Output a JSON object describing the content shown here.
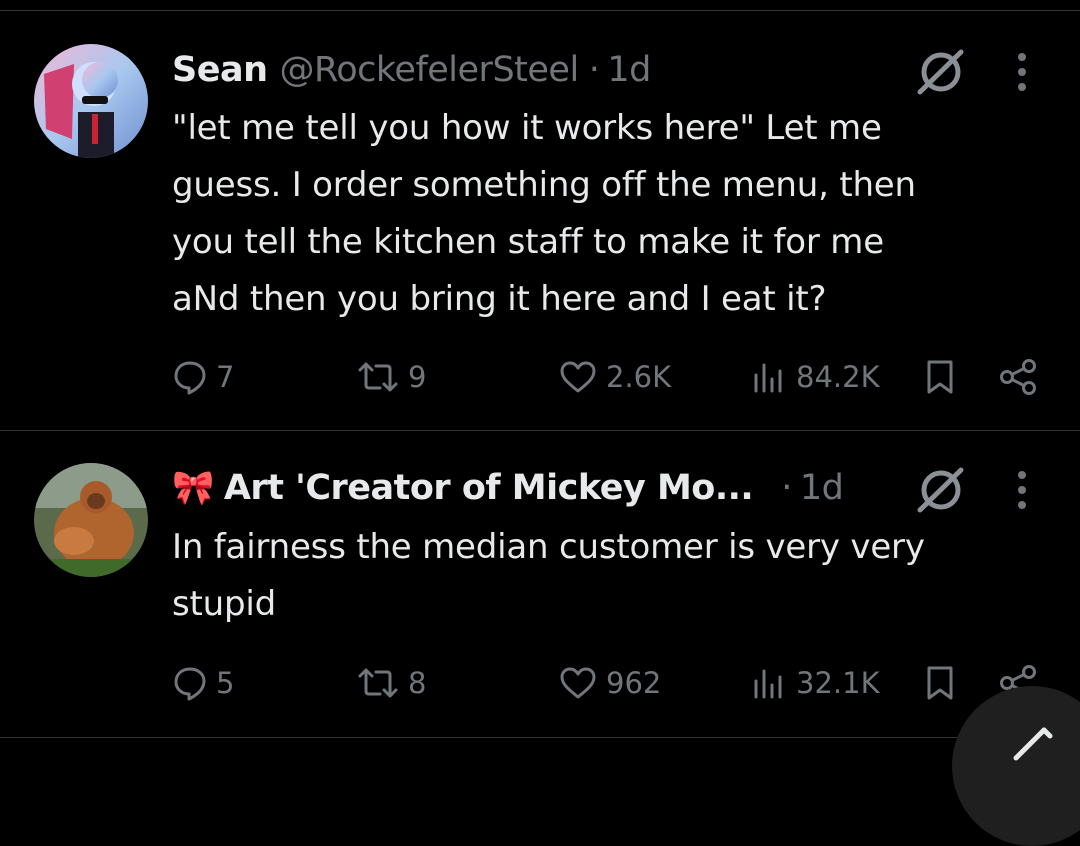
{
  "posts": [
    {
      "name": "Sean",
      "emoji": "",
      "handle": "@RockefelerSteel",
      "dot": "·",
      "time": "1d",
      "text_lines": [
        "\"let me tell you how it works here\" Let me",
        "guess. I order something off the menu, then",
        "you tell the kitchen staff to make it for me",
        "aNd then you bring it here and I eat it?"
      ],
      "replies": "7",
      "reposts": "9",
      "likes": "2.6K",
      "views": "84.2K"
    },
    {
      "name": "Art 'Creator of Mickey Mo...",
      "emoji": "🎀",
      "handle": "",
      "dot": "·",
      "time": "1d",
      "text_lines": [
        "In fairness the median customer is very very",
        "stupid"
      ],
      "replies": "5",
      "reposts": "8",
      "likes": "962",
      "views": "32.1K"
    }
  ],
  "colors": {
    "background": "#000000",
    "text": "#e7e9ea",
    "muted": "#71767b",
    "divider": "#2f3336"
  },
  "icons": [
    "reply-icon",
    "repost-icon",
    "like-icon",
    "views-icon",
    "bookmark-icon",
    "share-icon",
    "grok-icon",
    "more-icon",
    "compose-icon"
  ]
}
